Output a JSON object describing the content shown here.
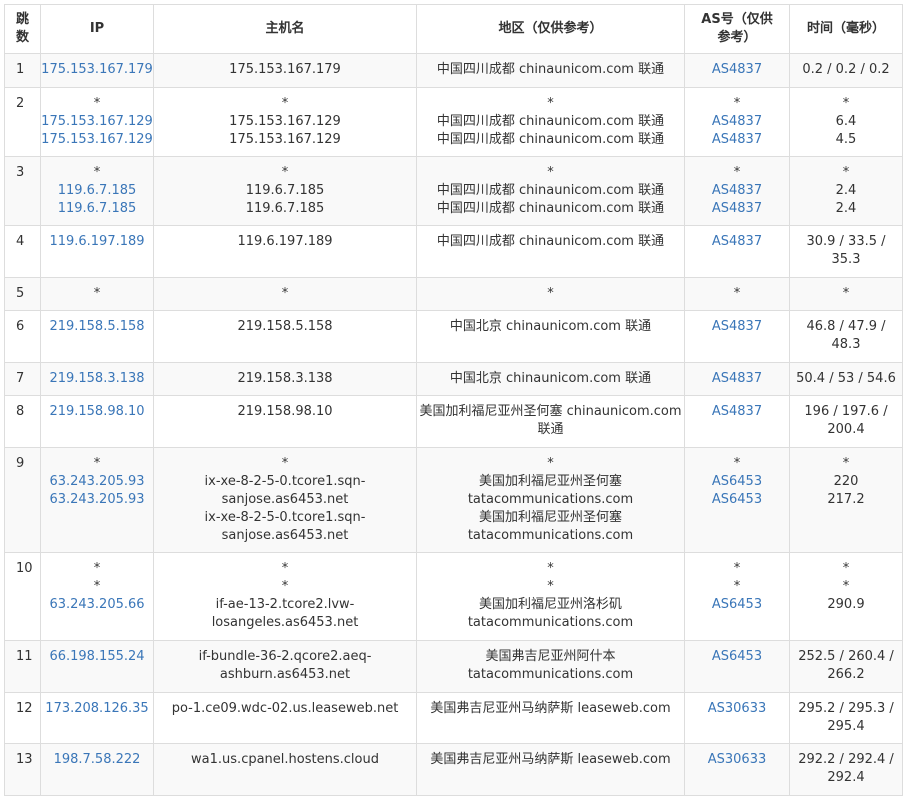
{
  "headers": [
    "跳数",
    "IP",
    "主机名",
    "地区（仅供参考）",
    "AS号（仅供参考）",
    "时间（毫秒）"
  ],
  "rows": [
    {
      "hop": "1",
      "ip": [
        "175.153.167.179"
      ],
      "host": [
        "175.153.167.179"
      ],
      "region": [
        "中国四川成都 chinaunicom.com 联通"
      ],
      "asn": [
        "AS4837"
      ],
      "time": [
        "0.2 / 0.2 / 0.2"
      ]
    },
    {
      "hop": "2",
      "ip": [
        "*",
        "175.153.167.129",
        "175.153.167.129"
      ],
      "host": [
        "*",
        "175.153.167.129",
        "175.153.167.129"
      ],
      "region": [
        "*",
        "中国四川成都 chinaunicom.com 联通",
        "中国四川成都 chinaunicom.com 联通"
      ],
      "asn": [
        "*",
        "AS4837",
        "AS4837"
      ],
      "time": [
        "*",
        "6.4",
        "4.5"
      ]
    },
    {
      "hop": "3",
      "ip": [
        "*",
        "119.6.7.185",
        "119.6.7.185"
      ],
      "host": [
        "*",
        "119.6.7.185",
        "119.6.7.185"
      ],
      "region": [
        "*",
        "中国四川成都 chinaunicom.com 联通",
        "中国四川成都 chinaunicom.com 联通"
      ],
      "asn": [
        "*",
        "AS4837",
        "AS4837"
      ],
      "time": [
        "*",
        "2.4",
        "2.4"
      ]
    },
    {
      "hop": "4",
      "ip": [
        "119.6.197.189"
      ],
      "host": [
        "119.6.197.189"
      ],
      "region": [
        "中国四川成都 chinaunicom.com 联通"
      ],
      "asn": [
        "AS4837"
      ],
      "time": [
        "30.9 / 33.5 /",
        "35.3"
      ]
    },
    {
      "hop": "5",
      "ip": [
        "*"
      ],
      "host": [
        "*"
      ],
      "region": [
        "*"
      ],
      "asn": [
        "*"
      ],
      "time": [
        "*"
      ]
    },
    {
      "hop": "6",
      "ip": [
        "219.158.5.158"
      ],
      "host": [
        "219.158.5.158"
      ],
      "region": [
        "中国北京 chinaunicom.com 联通"
      ],
      "asn": [
        "AS4837"
      ],
      "time": [
        "46.8 / 47.9 /",
        "48.3"
      ]
    },
    {
      "hop": "7",
      "ip": [
        "219.158.3.138"
      ],
      "host": [
        "219.158.3.138"
      ],
      "region": [
        "中国北京 chinaunicom.com 联通"
      ],
      "asn": [
        "AS4837"
      ],
      "time": [
        "50.4 / 53 / 54.6"
      ]
    },
    {
      "hop": "8",
      "ip": [
        "219.158.98.10"
      ],
      "host": [
        "219.158.98.10"
      ],
      "region": [
        "美国加利福尼亚州圣何塞 chinaunicom.com",
        "联通"
      ],
      "asn": [
        "AS4837"
      ],
      "time": [
        "196 / 197.6 /",
        "200.4"
      ]
    },
    {
      "hop": "9",
      "ip": [
        "*",
        "63.243.205.93",
        "63.243.205.93"
      ],
      "host": [
        "*",
        "ix-xe-8-2-5-0.tcore1.sqn-",
        "sanjose.as6453.net",
        "ix-xe-8-2-5-0.tcore1.sqn-",
        "sanjose.as6453.net"
      ],
      "region": [
        "*",
        "美国加利福尼亚州圣何塞",
        "tatacommunications.com",
        "美国加利福尼亚州圣何塞",
        "tatacommunications.com"
      ],
      "asn": [
        "*",
        "AS6453",
        "AS6453"
      ],
      "time": [
        "*",
        "220",
        "217.2"
      ]
    },
    {
      "hop": "10",
      "ip": [
        "*",
        "*",
        "63.243.205.66"
      ],
      "host": [
        "*",
        "*",
        "if-ae-13-2.tcore2.lvw-",
        "losangeles.as6453.net"
      ],
      "region": [
        "*",
        "*",
        "美国加利福尼亚州洛杉矶",
        "tatacommunications.com"
      ],
      "asn": [
        "*",
        "*",
        "AS6453"
      ],
      "time": [
        "*",
        "*",
        "290.9"
      ]
    },
    {
      "hop": "11",
      "ip": [
        "66.198.155.24"
      ],
      "host": [
        "if-bundle-36-2.qcore2.aeq-",
        "ashburn.as6453.net"
      ],
      "region": [
        "美国弗吉尼亚州阿什本",
        "tatacommunications.com"
      ],
      "asn": [
        "AS6453"
      ],
      "time": [
        "252.5 / 260.4 /",
        "266.2"
      ]
    },
    {
      "hop": "12",
      "ip": [
        "173.208.126.35"
      ],
      "host": [
        "po-1.ce09.wdc-02.us.leaseweb.net"
      ],
      "region": [
        "美国弗吉尼亚州马纳萨斯 leaseweb.com"
      ],
      "asn": [
        "AS30633"
      ],
      "time": [
        "295.2 / 295.3 /",
        "295.4"
      ]
    },
    {
      "hop": "13",
      "ip": [
        "198.7.58.222"
      ],
      "host": [
        "wa1.us.cpanel.hostens.cloud"
      ],
      "region": [
        "美国弗吉尼亚州马纳萨斯 leaseweb.com"
      ],
      "asn": [
        "AS30633"
      ],
      "time": [
        "292.2 / 292.4 /",
        "292.4"
      ]
    }
  ],
  "colors": {
    "link": "#3a76b8",
    "border": "#dddddd",
    "text": "#333333",
    "alt_row": "#f9f9f9"
  }
}
